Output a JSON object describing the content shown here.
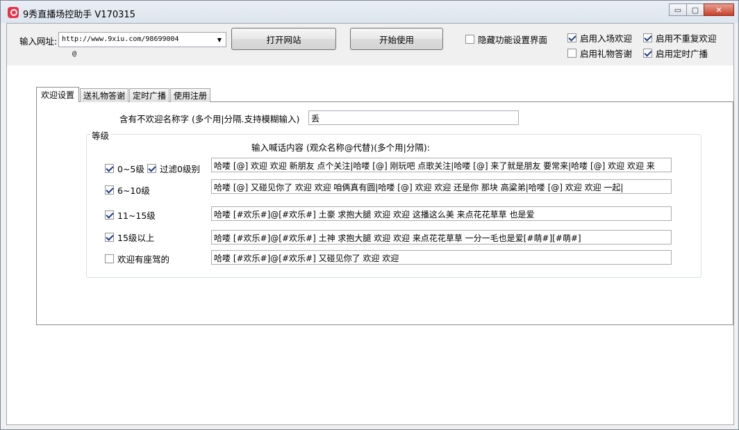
{
  "window": {
    "title": "9秀直播场控助手 V170315",
    "controls": {
      "minimize": "▭",
      "maximize": "▢",
      "close": "✕"
    }
  },
  "top": {
    "url_label": "输入网址:",
    "url_value": "http://www.9xiu.com/98699004",
    "at_sign": "@",
    "open_site_button": "打开网站",
    "start_button": "开始使用",
    "hide_settings": {
      "label": "隐藏功能设置界面",
      "checked": false
    },
    "enable_entry_welcome": {
      "label": "启用入场欢迎",
      "checked": true
    },
    "enable_no_repeat_welcome": {
      "label": "启用不重复欢迎",
      "checked": true
    },
    "enable_gift_thanks": {
      "label": "启用礼物答谢",
      "checked": false
    },
    "enable_timed_broadcast": {
      "label": "启用定时广播",
      "checked": true
    }
  },
  "tabs": [
    "欢迎设置",
    "送礼物答谢",
    "定时广播",
    "使用注册"
  ],
  "welcome": {
    "exclude_label": "含有不欢迎名称字 (多个用|分隔.支持模糊输入)",
    "exclude_value": "丢",
    "group_title": "等级",
    "content_header": "输入喊话内容 (观众名称@代替)(多个用|分隔):",
    "rows": [
      {
        "label": "0~5级",
        "checked": true,
        "text": "哈喽 [@] 欢迎 欢迎 新朋友 点个关注|哈喽 [@] 刚玩吧 点歌关注|哈喽 [@] 来了就是朋友 要常来|哈喽 [@] 欢迎 欢迎 来"
      },
      {
        "label": "6~10级",
        "checked": true,
        "text": "哈喽 [@] 又碰见你了 欢迎 欢迎   咱俩真有圆|哈喽 [@]  欢迎 欢迎  还是你  那块 高粱弟|哈喽 [@]  欢迎 欢迎  一起|"
      },
      {
        "label": "11~15级",
        "checked": true,
        "text": "哈喽 [#欢乐#]@[#欢乐#]  土豪 求抱大腿 欢迎 欢迎  这播这么美  来点花花草草 也是爱"
      },
      {
        "label": "15级以上",
        "checked": true,
        "text": "哈喽 [#欢乐#]@[#欢乐#] 土神 求抱大腿 欢迎 欢迎  来点花花草草  一分一毛也是爱[#萌#][#萌#]"
      },
      {
        "label": "欢迎有座驾的",
        "checked": false,
        "text": "哈喽 [#欢乐#]@[#欢乐#] 又碰见你了 欢迎 欢迎"
      }
    ],
    "filter_zero": {
      "label": "过滤0级别",
      "checked": true
    }
  }
}
